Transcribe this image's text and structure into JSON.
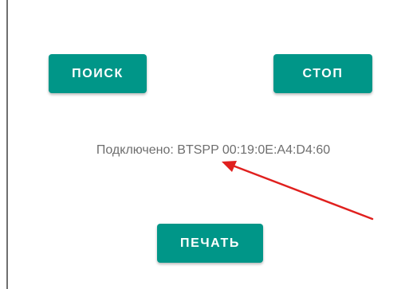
{
  "buttons": {
    "search_label": "ПОИСК",
    "stop_label": "СТОП",
    "print_label": "ПЕЧАТЬ"
  },
  "status": {
    "text": "Подключено: BTSPP 00:19:0E:A4:D4:60"
  },
  "colors": {
    "accent": "#009688",
    "button_text": "#ffffff",
    "status_text": "#6e6e6e",
    "annotation_arrow": "#e0201e"
  }
}
